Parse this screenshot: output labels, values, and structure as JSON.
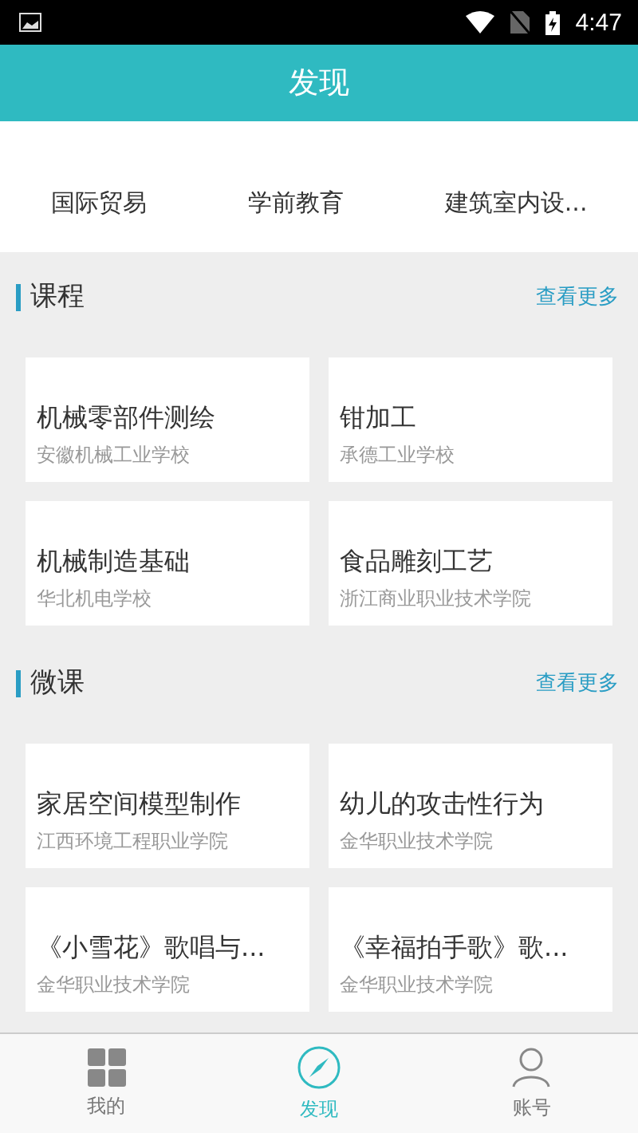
{
  "status_bar": {
    "time": "4:47"
  },
  "header": {
    "title": "发现"
  },
  "categories": [
    {
      "label": "国际贸易"
    },
    {
      "label": "学前教育"
    },
    {
      "label": "建筑室内设..."
    }
  ],
  "sections": [
    {
      "title": "课程",
      "more": "查看更多",
      "cards": [
        {
          "title": "机械零部件测绘",
          "school": "安徽机械工业学校"
        },
        {
          "title": "钳加工",
          "school": "承德工业学校"
        },
        {
          "title": "机械制造基础",
          "school": "华北机电学校"
        },
        {
          "title": "食品雕刻工艺",
          "school": "浙江商业职业技术学院"
        }
      ]
    },
    {
      "title": "微课",
      "more": "查看更多",
      "cards": [
        {
          "title": "家居空间模型制作",
          "school": "江西环境工程职业学院"
        },
        {
          "title": "幼儿的攻击性行为",
          "school": "金华职业技术学院"
        },
        {
          "title": "《小雪花》歌唱与...",
          "school": "金华职业技术学院"
        },
        {
          "title": "《幸福拍手歌》歌...",
          "school": "金华职业技术学院"
        }
      ]
    }
  ],
  "nav": [
    {
      "label": "我的",
      "kind": "grid",
      "selected": false
    },
    {
      "label": "发现",
      "kind": "compass",
      "selected": true
    },
    {
      "label": "账号",
      "kind": "person",
      "selected": false
    }
  ]
}
